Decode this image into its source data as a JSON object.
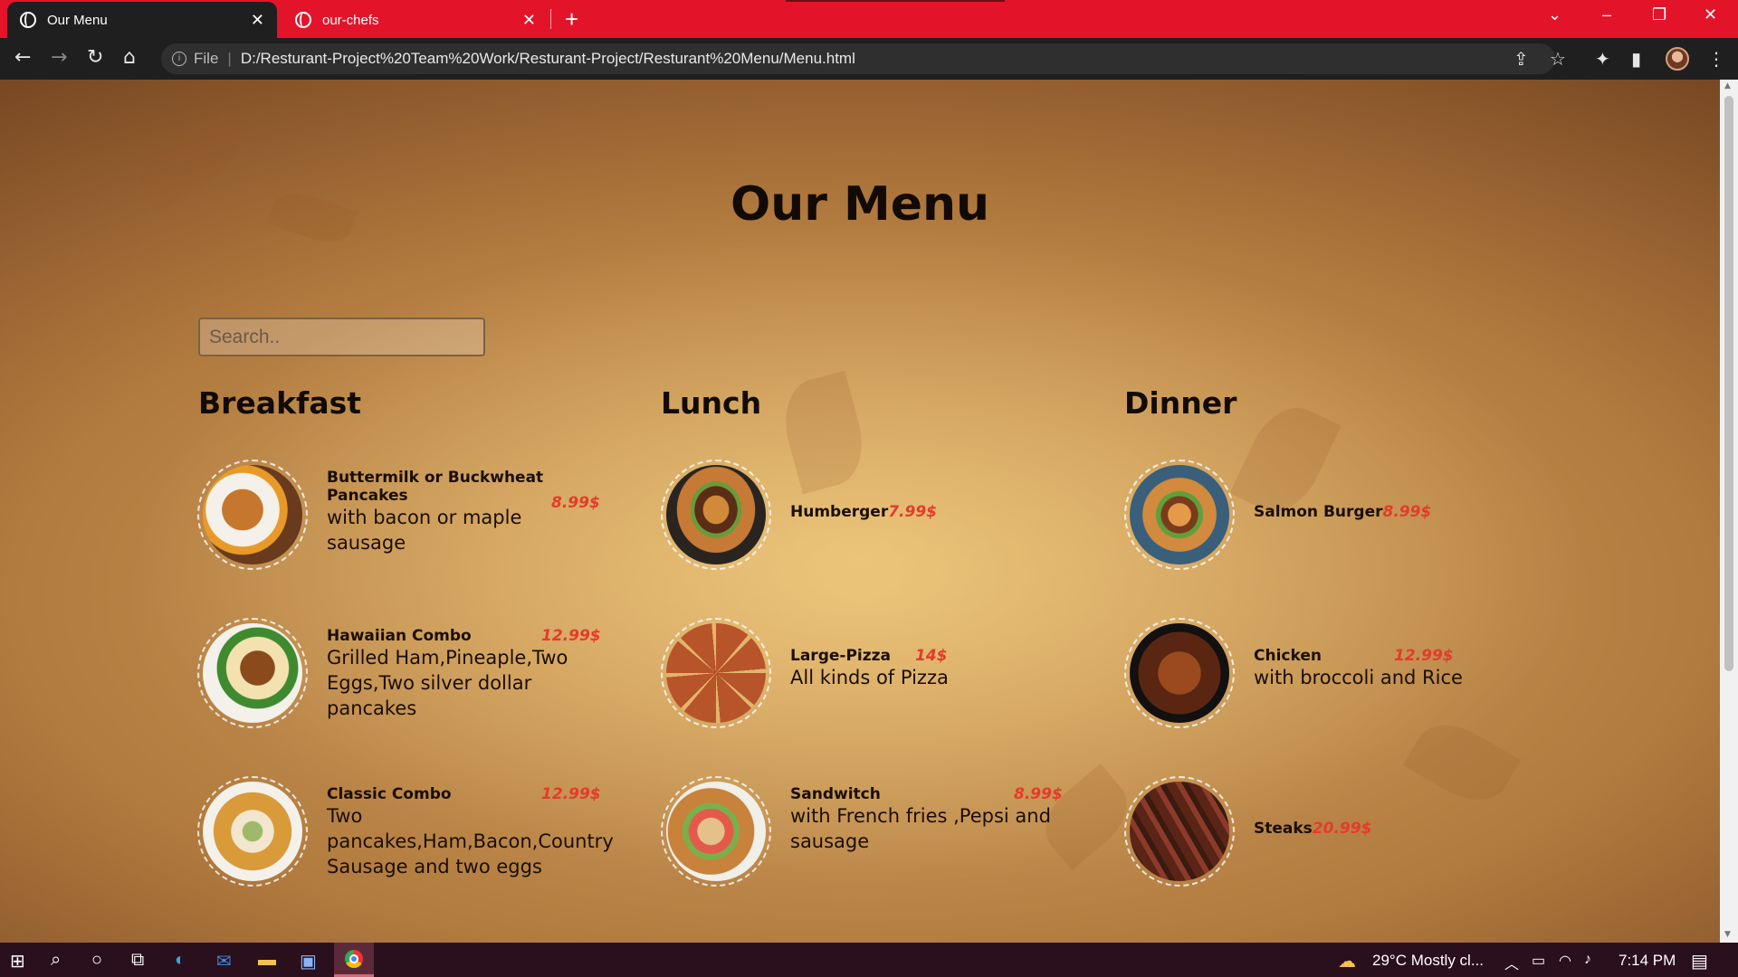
{
  "browser": {
    "tabs": [
      {
        "title": "Our Menu",
        "active": true
      },
      {
        "title": "our-chefs",
        "active": false
      }
    ],
    "address": {
      "scheme_label": "File",
      "url": "D:/Resturant-Project%20Team%20Work/Resturant-Project/Resturant%20Menu/Menu.html"
    }
  },
  "page": {
    "title": "Our Menu",
    "search": {
      "placeholder": "Search.."
    },
    "columns": [
      {
        "heading": "Breakfast",
        "items": [
          {
            "name": "Buttermilk or Buckwheat Pancakes",
            "desc": "with bacon or maple sausage",
            "price": "8.99$"
          },
          {
            "name": "Hawaiian Combo",
            "desc": "Grilled Ham,Pineaple,Two Eggs,Two silver dollar pancakes",
            "price": "12.99$"
          },
          {
            "name": "Classic Combo",
            "desc": "Two pancakes,Ham,Bacon,Country Sausage and two eggs",
            "price": "12.99$"
          }
        ]
      },
      {
        "heading": "Lunch",
        "items": [
          {
            "name": "Humberger",
            "desc": "",
            "price": "7.99$"
          },
          {
            "name": "Large-Pizza",
            "desc": "All kinds of Pizza",
            "price": "14$"
          },
          {
            "name": "Sandwitch",
            "desc": "with French fries ,Pepsi and sausage",
            "price": "8.99$"
          }
        ]
      },
      {
        "heading": "Dinner",
        "items": [
          {
            "name": "Salmon Burger",
            "desc": "",
            "price": "8.99$"
          },
          {
            "name": "Chicken",
            "desc": "with broccoli and Rice",
            "price": "12.99$"
          },
          {
            "name": "Steaks",
            "desc": "",
            "price": "20.99$"
          }
        ]
      }
    ]
  },
  "taskbar": {
    "weather": "29°C  Mostly cl...",
    "time": "7:14 PM"
  },
  "colors": {
    "tab_strip": "#e3142a",
    "price": "#e53b2b",
    "heading": "#120a04"
  }
}
